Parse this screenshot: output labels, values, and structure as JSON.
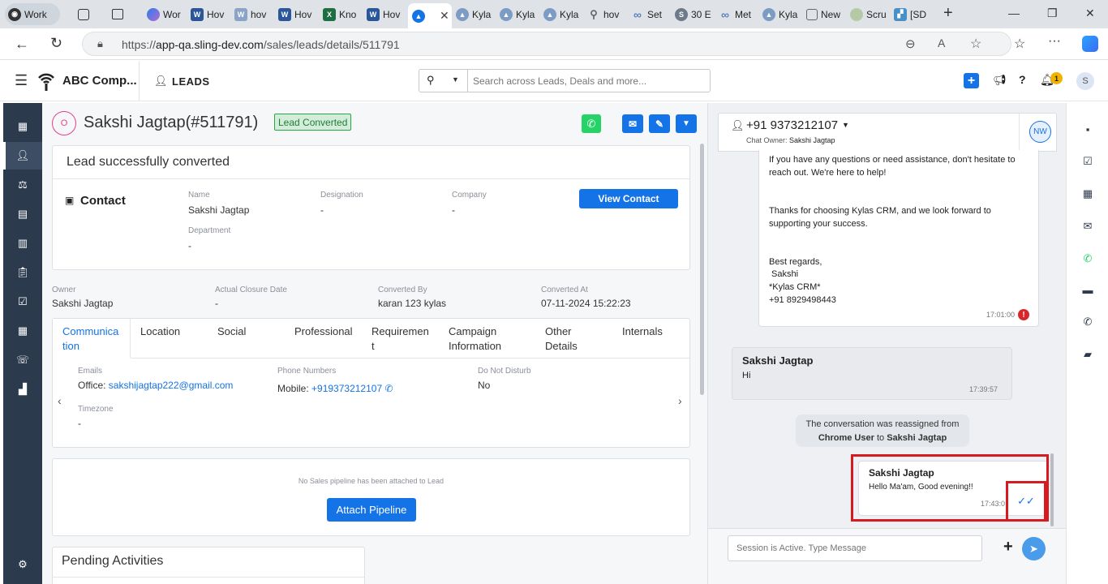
{
  "browser": {
    "tabs": [
      {
        "label": "Work",
        "icon": "profile-icon"
      },
      {
        "label": "",
        "icon": "collections-icon"
      },
      {
        "label": "",
        "icon": "tab-actions-icon"
      },
      {
        "label": "Wor",
        "icon": "copilot-icon"
      },
      {
        "label": "Hov",
        "icon": "word-icon"
      },
      {
        "label": "hov",
        "icon": "word-icon"
      },
      {
        "label": "Hov",
        "icon": "word-icon"
      },
      {
        "label": "Kno",
        "icon": "excel-icon"
      },
      {
        "label": "Hov",
        "icon": "word-icon"
      },
      {
        "label": "",
        "icon": "kylas-icon"
      },
      {
        "label": "Kyla",
        "icon": "kylas-icon"
      },
      {
        "label": "Kyla",
        "icon": "kylas-icon"
      },
      {
        "label": "Kyla",
        "icon": "kylas-icon"
      },
      {
        "label": "hov",
        "icon": "search-icon"
      },
      {
        "label": "Set",
        "icon": "meta-icon"
      },
      {
        "label": "30 E",
        "icon": "s-icon"
      },
      {
        "label": "Met",
        "icon": "meta-icon"
      },
      {
        "label": "Kyla",
        "icon": "kylas-icon"
      },
      {
        "label": "New",
        "icon": "newtab-icon"
      },
      {
        "label": "Scru",
        "icon": "scrum-icon"
      },
      {
        "label": "[SD",
        "icon": "jira-icon"
      }
    ],
    "url_prefix": "https://",
    "url_host": "app-qa.sling-dev.com",
    "url_path": "/sales/leads/details/511791"
  },
  "header": {
    "company": "ABC Comp...",
    "module": "LEADS",
    "search_placeholder": "Search across Leads, Deals and more...",
    "notification_count": "1",
    "user_initial": "S"
  },
  "lead": {
    "avatar_letter": "O",
    "title": "Sakshi Jagtap(#511791)",
    "status_badge": "Lead Converted",
    "converted_message": "Lead successfully converted",
    "contact_heading": "Contact",
    "view_contact": "View Contact",
    "contact_fields": [
      {
        "label": "Name",
        "value": "Sakshi Jagtap"
      },
      {
        "label": "Designation",
        "value": "-"
      },
      {
        "label": "Company",
        "value": "-"
      },
      {
        "label": "Department",
        "value": "-"
      }
    ],
    "meta_fields": [
      {
        "label": "Owner",
        "value": "Sakshi Jagtap"
      },
      {
        "label": "Actual Closure Date",
        "value": "-"
      },
      {
        "label": "Converted By",
        "value": "karan 123 kylas"
      },
      {
        "label": "Converted At",
        "value": "07-11-2024 15:22:23"
      }
    ],
    "tabs": [
      "Communica tion",
      "Location",
      "Social",
      "Professional",
      "Requiremen t",
      "Campaign Information",
      "Other Details",
      "Internals"
    ],
    "tab_lines": [
      [
        "Communica",
        "tion"
      ],
      [
        "Location"
      ],
      [
        "Social"
      ],
      [
        "Professional"
      ],
      [
        "Requiremen",
        "t"
      ],
      [
        "Campaign",
        "Information"
      ],
      [
        "Other",
        "Details"
      ],
      [
        "Internals"
      ]
    ],
    "comm": {
      "emails_label": "Emails",
      "email_prefix": "Office: ",
      "email": "sakshijagtap222@gmail.com",
      "phones_label": "Phone Numbers",
      "phone_prefix": "Mobile: ",
      "phone": "+919373212107",
      "dnd_label": "Do Not Disturb",
      "dnd_value": "No",
      "timezone_label": "Timezone",
      "timezone_value": "-"
    },
    "pipeline_empty": "No Sales pipeline has been attached to Lead",
    "attach_pipeline": "Attach Pipeline",
    "pending_activities": "Pending Activities"
  },
  "chat": {
    "phone": "+91 9373212107",
    "owner_label": "Chat Owner: ",
    "owner_name": "Sakshi Jagtap",
    "agent_initials": "NW",
    "msg1_lines": [
      "If you have any questions or need assistance, don't hesitate to",
      "reach out. We're here to help!",
      "",
      "",
      "Thanks for choosing Kylas CRM, and we look forward to",
      "supporting your success.",
      "",
      "",
      "Best regards,",
      " Sakshi",
      "*Kylas CRM*",
      "+91 8929498443"
    ],
    "msg1_time": "17:01:00",
    "msg2_sender": "Sakshi Jagtap",
    "msg2_text": "Hi",
    "msg2_time": "17:39:57",
    "system_line1": "The conversation was reassigned from",
    "system_from": "Chrome User",
    "system_to_word": " to ",
    "system_to": "Sakshi Jagtap",
    "msg3_sender": "Sakshi Jagtap",
    "msg3_text": "Hello Ma'am, Good evening!!",
    "msg3_time": "17:43:0",
    "input_placeholder": "Session is Active. Type Message"
  },
  "colors": {
    "primary": "#1473e6",
    "sidebar": "#2c3a4d",
    "converted_green": "#28a745",
    "error_red": "#d9262b",
    "highlight_red": "#d71920",
    "whatsapp": "#25d366"
  }
}
